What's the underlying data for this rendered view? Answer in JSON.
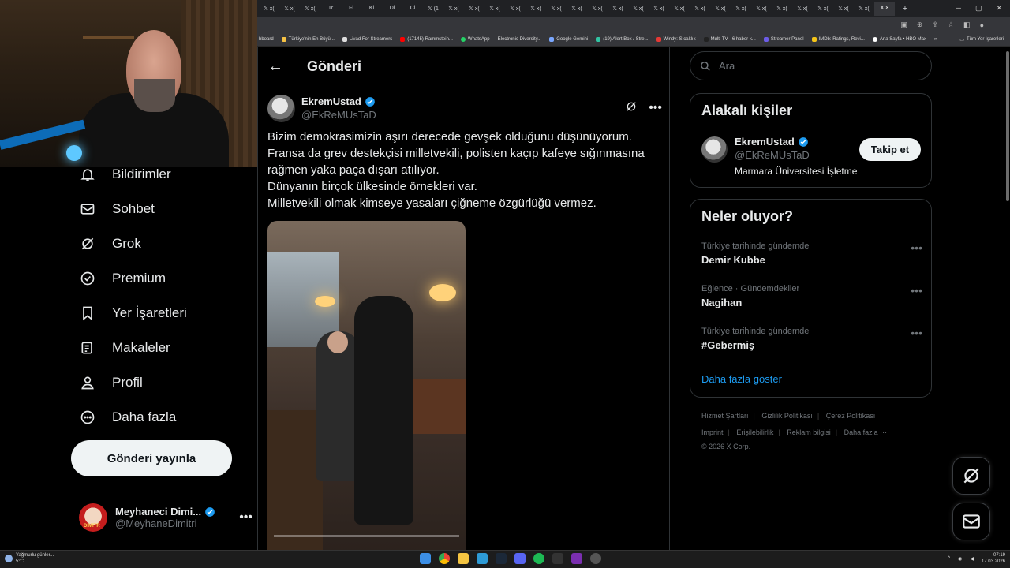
{
  "browser": {
    "tabs": [
      "𝕏 x(",
      "𝕏 x(",
      "𝕏 x(",
      "Tr",
      "Fi",
      "Ki",
      "Di",
      "Cl",
      "𝕏 (1",
      "𝕏 x(",
      "𝕏 x(",
      "𝕏 x(",
      "𝕏 x(",
      "𝕏 x(",
      "𝕏 x(",
      "𝕏 x(",
      "𝕏 x(",
      "𝕏 x(",
      "𝕏 x(",
      "𝕏 x(",
      "𝕏 x(",
      "𝕏 x(",
      "𝕏 x(",
      "𝕏 x(",
      "𝕏 x(",
      "𝕏 x(",
      "𝕏 x(",
      "𝕏 x(",
      "𝕏 x(",
      "𝕏 x(",
      "X ×"
    ],
    "new_tab": "+",
    "bookmarks": [
      "hboard",
      "Türkiye'nin En Büyü...",
      "Livad For Streamers",
      "(17145) Rammstein...",
      "WhatsApp",
      "Electronic Diversity...",
      "Google Gemini",
      "(19) Alert Box / Stre...",
      "Windy: Sıcaklık",
      "Multi TV - 6 haber k...",
      "Streamer Panel",
      "IMDb: Ratings, Revi...",
      "Ana Sayfa • HBO Max"
    ],
    "bookmarks_more": "»",
    "bookmarks_folder": "Tüm Yer İşaretleri"
  },
  "nav": {
    "items": [
      {
        "label": "Bildirimler",
        "icon": "bell-icon"
      },
      {
        "label": "Sohbet",
        "icon": "mail-icon"
      },
      {
        "label": "Grok",
        "icon": "grok-icon"
      },
      {
        "label": "Premium",
        "icon": "verified-icon"
      },
      {
        "label": "Yer İşaretleri",
        "icon": "bookmark-icon"
      },
      {
        "label": "Makaleler",
        "icon": "article-icon"
      },
      {
        "label": "Profil",
        "icon": "person-icon"
      },
      {
        "label": "Daha fazla",
        "icon": "more-circle-icon"
      }
    ],
    "post_button": "Gönderi yayınla",
    "account": {
      "name": "Meyhaneci Dimi...",
      "handle": "@MeyhaneDimitri",
      "avatar_text": "DIMITR"
    }
  },
  "main": {
    "title": "Gönderi",
    "tweet": {
      "name": "EkremUstad",
      "handle": "@EkReMUsTaD",
      "lines": [
        "Bizim demokrasimizin aşırı derecede gevşek olduğunu düşünüyorum.",
        "Fransa da grev destekçisi milletvekili, polisten kaçıp kafeye sığınmasına",
        "rağmen yaka paça dışarı atılıyor.",
        "Dünyanın birçok ülkesinde örnekleri var.",
        "Milletvekili olmak kimseye yasaları çiğneme özgürlüğü vermez."
      ]
    }
  },
  "right": {
    "search_placeholder": "Ara",
    "related": {
      "title": "Alakalı kişiler",
      "name": "EkremUstad",
      "handle": "@EkReMUsTaD",
      "bio": "Marmara Üniversitesi İşletme",
      "follow": "Takip et"
    },
    "trends": {
      "title": "Neler oluyor?",
      "items": [
        {
          "context": "Türkiye tarihinde gündemde",
          "name": "Demir Kubbe"
        },
        {
          "context": "Eğlence · Gündemdekiler",
          "name": "Nagihan"
        },
        {
          "context": "Türkiye tarihinde gündemde",
          "name": "#Gebermiş"
        }
      ],
      "show_more": "Daha fazla göster"
    },
    "footer": {
      "row1": [
        "Hizmet Şartları",
        "Gizlilik Politikası",
        "Çerez Politikası"
      ],
      "row2": [
        "Imprint",
        "Erişilebilirlik",
        "Reklam bilgisi",
        "Daha fazla ···"
      ],
      "copyright": "© 2026 X Corp."
    }
  },
  "taskbar": {
    "weather": "Yağmurlu günler...",
    "temp": "5°C",
    "time": "07:19",
    "date": "17.03.2026"
  },
  "colors": {
    "verified": "#1d9bf0",
    "link": "#1d9bf0",
    "background": "#000000"
  }
}
